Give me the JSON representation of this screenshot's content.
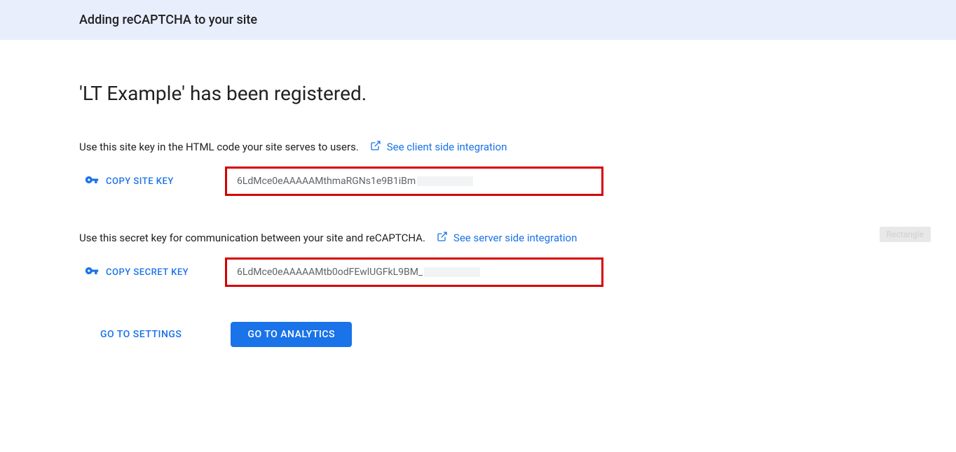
{
  "header": {
    "title": "Adding reCAPTCHA to your site"
  },
  "main": {
    "page_title": "'LT Example' has been registered.",
    "site_key_section": {
      "description": "Use this site key in the HTML code your site serves to users.",
      "link_text": "See client side integration",
      "copy_label": "COPY SITE KEY",
      "key_value": "6LdMce0eAAAAAMthmaRGNs1e9B1iBm"
    },
    "secret_key_section": {
      "description": "Use this secret key for communication between your site and reCAPTCHA.",
      "link_text": "See server side integration",
      "copy_label": "COPY SECRET KEY",
      "key_value": "6LdMce0eAAAAAMtb0odFEwlUGFkL9BM_"
    },
    "buttons": {
      "settings": "GO TO SETTINGS",
      "analytics": "GO TO ANALYTICS"
    }
  },
  "overlay": {
    "rectangle_label": "Rectangle"
  }
}
